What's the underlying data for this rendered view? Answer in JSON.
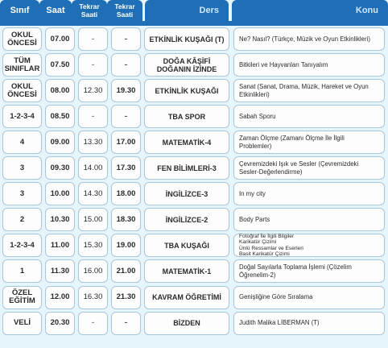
{
  "header": {
    "sinif": "Sınıf",
    "saat": "Saat",
    "tekrar1": "Tekrar\nSaati",
    "tekrar2": "Tekrar\nSaati",
    "ders": "Ders",
    "konu": "Konu"
  },
  "rows": [
    {
      "sinif": "OKUL\nÖNCESİ",
      "saat": "07.00",
      "t1": "-",
      "t2": "-",
      "ders": "ETKİNLİK KUŞAĞI (T)",
      "konu": "Ne? Nasıl? (Türkçe, Müzik ve Oyun Etkinlikleri)"
    },
    {
      "sinif": "TÜM\nSINIFLAR",
      "saat": "07.50",
      "t1": "-",
      "t2": "-",
      "ders": "DOĞA KÂŞİFİ\nDOĞANIN İZİNDE",
      "konu": "Bitkileri ve Hayvanları Tanıyalım"
    },
    {
      "sinif": "OKUL\nÖNCESİ",
      "saat": "08.00",
      "t1": "12.30",
      "t2": "19.30",
      "ders": "ETKİNLİK KUŞAĞI",
      "konu": "Sanat (Sanat, Drama, Müzik, Hareket ve Oyun\nEtkinlikleri)"
    },
    {
      "sinif": "1-2-3-4",
      "saat": "08.50",
      "t1": "-",
      "t2": "-",
      "ders": "TBA SPOR",
      "konu": "Sabah Sporu"
    },
    {
      "sinif": "4",
      "saat": "09.00",
      "t1": "13.30",
      "t2": "17.00",
      "ders": "MATEMATİK-4",
      "konu": "Zaman Ölçme (Zamanı Ölçme İle İlgili\nProblemler)"
    },
    {
      "sinif": "3",
      "saat": "09.30",
      "t1": "14.00",
      "t2": "17.30",
      "ders": "FEN BİLİMLERİ-3",
      "konu": "Çevremizdeki Işık ve Sesler (Çevremizdeki\nSesler-Değerlendirme)"
    },
    {
      "sinif": "3",
      "saat": "10.00",
      "t1": "14.30",
      "t2": "18.00",
      "ders": "İNGİLİZCE-3",
      "konu": "In my city"
    },
    {
      "sinif": "2",
      "saat": "10.30",
      "t1": "15.00",
      "t2": "18.30",
      "ders": "İNGİLİZCE-2",
      "konu": "Body Parts"
    },
    {
      "sinif": "1-2-3-4",
      "saat": "11.00",
      "t1": "15.30",
      "t2": "19.00",
      "ders": "TBA KUŞAĞI",
      "konu": "Fotoğraf İle İlgili Bilgiler\nKarikatür Çizimi\nÜnlü Ressamlar ve Eserleri\nBasit Karikatür Çizimi",
      "small": true
    },
    {
      "sinif": "1",
      "saat": "11.30",
      "t1": "16.00",
      "t2": "21.00",
      "ders": "MATEMATİK-1",
      "konu": "Doğal Sayılarla Toplama İşlemi (Çözelim\nÖğrenelim-2)"
    },
    {
      "sinif": "ÖZEL\nEĞİTİM",
      "saat": "12.00",
      "t1": "16.30",
      "t2": "21.30",
      "ders": "KAVRAM ÖĞRETİMİ",
      "konu": "Genişliğine Göre Sıralama"
    },
    {
      "sinif": "VELİ",
      "saat": "20.30",
      "t1": "-",
      "t2": "-",
      "ders": "BİZDEN",
      "konu": "Judith Malika LİBERMAN  (T)"
    }
  ]
}
